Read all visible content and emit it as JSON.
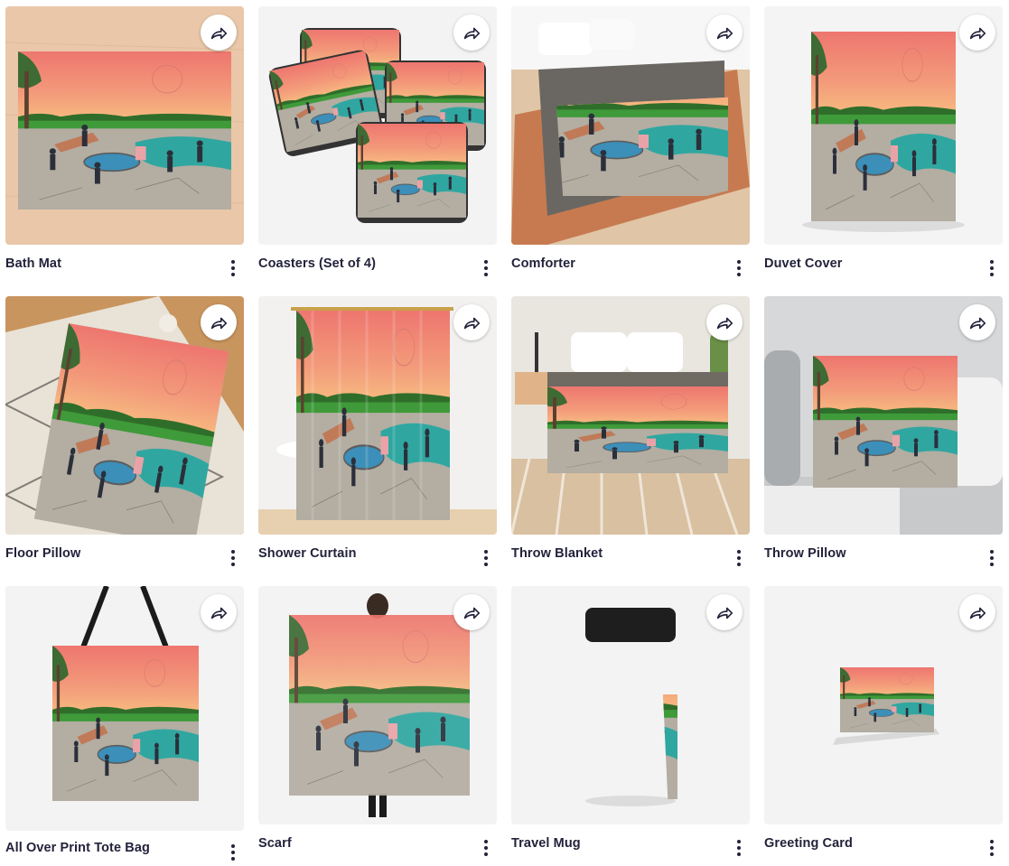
{
  "products": [
    {
      "title": "Bath Mat",
      "scene": "bathmat"
    },
    {
      "title": "Coasters (Set of 4)",
      "scene": "coasters"
    },
    {
      "title": "Comforter",
      "scene": "comforter"
    },
    {
      "title": "Duvet Cover",
      "scene": "duvet"
    },
    {
      "title": "Floor Pillow",
      "scene": "floorpillow"
    },
    {
      "title": "Shower Curtain",
      "scene": "shower"
    },
    {
      "title": "Throw Blanket",
      "scene": "throwblanket"
    },
    {
      "title": "Throw Pillow",
      "scene": "throwpillow"
    },
    {
      "title": "All Over Print Tote Bag",
      "scene": "tote"
    },
    {
      "title": "Scarf",
      "scene": "scarf"
    },
    {
      "title": "Travel Mug",
      "scene": "mug"
    },
    {
      "title": "Greeting Card",
      "scene": "card"
    }
  ],
  "icons": {
    "share": "share-arrow-icon",
    "menu": "more-vertical-icon"
  },
  "colors": {
    "title": "#22223b",
    "sky_top": "#ef7a72",
    "sky_bottom": "#f6b07a",
    "grass": "#3f9a3a",
    "pool": "#2fa7a0",
    "ground": "#a8a196"
  }
}
